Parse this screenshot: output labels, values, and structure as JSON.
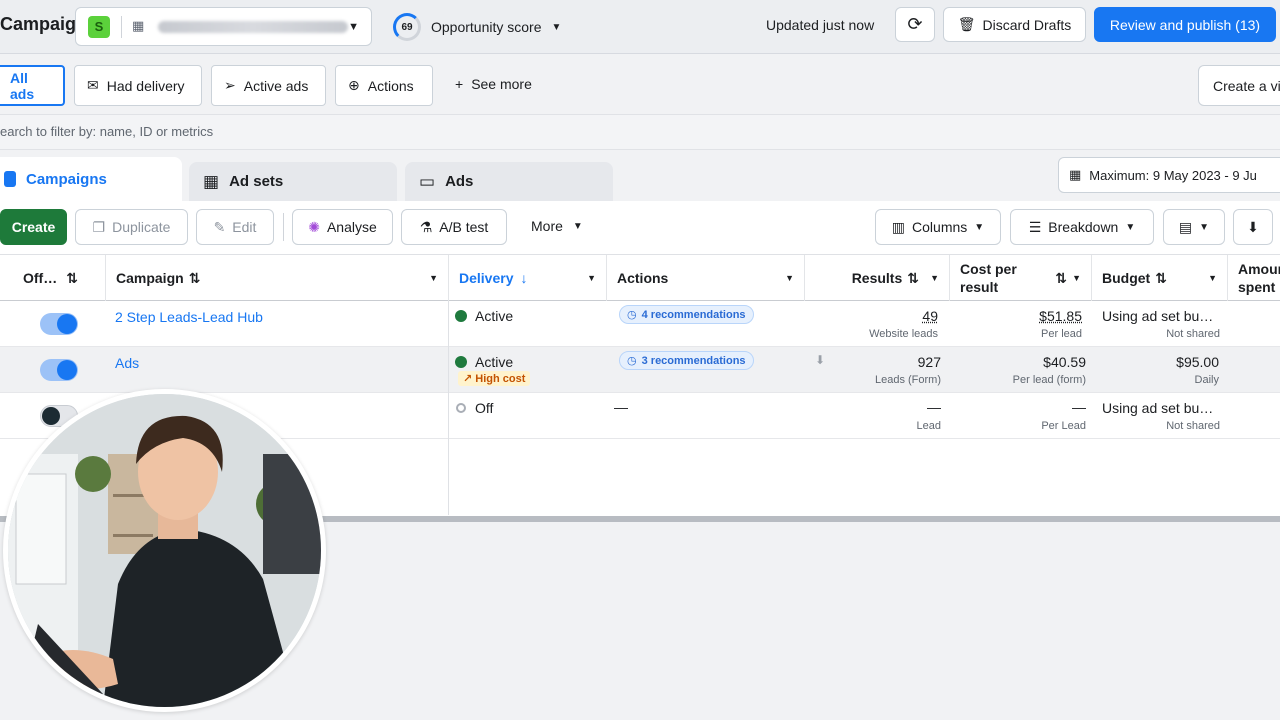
{
  "header": {
    "title": "Campaigns",
    "account_badge": "S",
    "opportunity_score": "69",
    "opportunity_label": "Opportunity score",
    "updated_text": "Updated just now",
    "discard_label": "Discard Drafts",
    "publish_label": "Review and publish (13)"
  },
  "filters": {
    "chips": [
      "All ads",
      "Had delivery",
      "Active ads",
      "Actions"
    ],
    "see_more": "See more",
    "create_view": "Create a vi",
    "search_placeholder": "earch to filter by: name, ID or metrics"
  },
  "tabs": [
    "Campaigns",
    "Ad sets",
    "Ads"
  ],
  "date_range": "Maximum: 9 May 2023 - 9 Ju",
  "toolbar": {
    "create": "Create",
    "duplicate": "Duplicate",
    "edit": "Edit",
    "analyse": "Analyse",
    "ab_test": "A/B test",
    "more": "More",
    "columns": "Columns",
    "breakdown": "Breakdown"
  },
  "columns": {
    "offon": "Off…",
    "campaign": "Campaign",
    "delivery": "Delivery",
    "actions": "Actions",
    "results": "Results",
    "cost_line1": "Cost per",
    "cost_line2": "result",
    "budget": "Budget",
    "amount_line1": "Amour",
    "amount_line2": "spent"
  },
  "rows": [
    {
      "toggle": "on",
      "campaign": "2 Step Leads-Lead Hub",
      "delivery": "Active",
      "actions": "4 recommendations",
      "results": "49",
      "results_sub": "Website leads",
      "cost": "$51.85",
      "cost_sub": "Per lead",
      "budget": "Using ad set bu…",
      "budget_sub": "Not shared"
    },
    {
      "toggle": "on",
      "campaign": "Ads",
      "delivery": "Active",
      "delivery_flag": "High cost",
      "actions": "3 recommendations",
      "results": "927",
      "results_sub": "Leads (Form)",
      "cost": "$40.59",
      "cost_sub": "Per lead (form)",
      "budget": "$95.00",
      "budget_sub": "Daily"
    },
    {
      "toggle": "off",
      "campaign": "",
      "delivery": "Off",
      "actions": "—",
      "results": "—",
      "results_sub": "Lead",
      "cost": "—",
      "cost_sub": "Per Lead",
      "budget": "Using ad set bu…",
      "budget_sub": "Not shared"
    }
  ],
  "colors": {
    "primary_blue": "#1877f2",
    "create_green": "#1e7a3a",
    "active_dot": "#1f7a3e",
    "high_cost_bg": "#fff3cd"
  }
}
